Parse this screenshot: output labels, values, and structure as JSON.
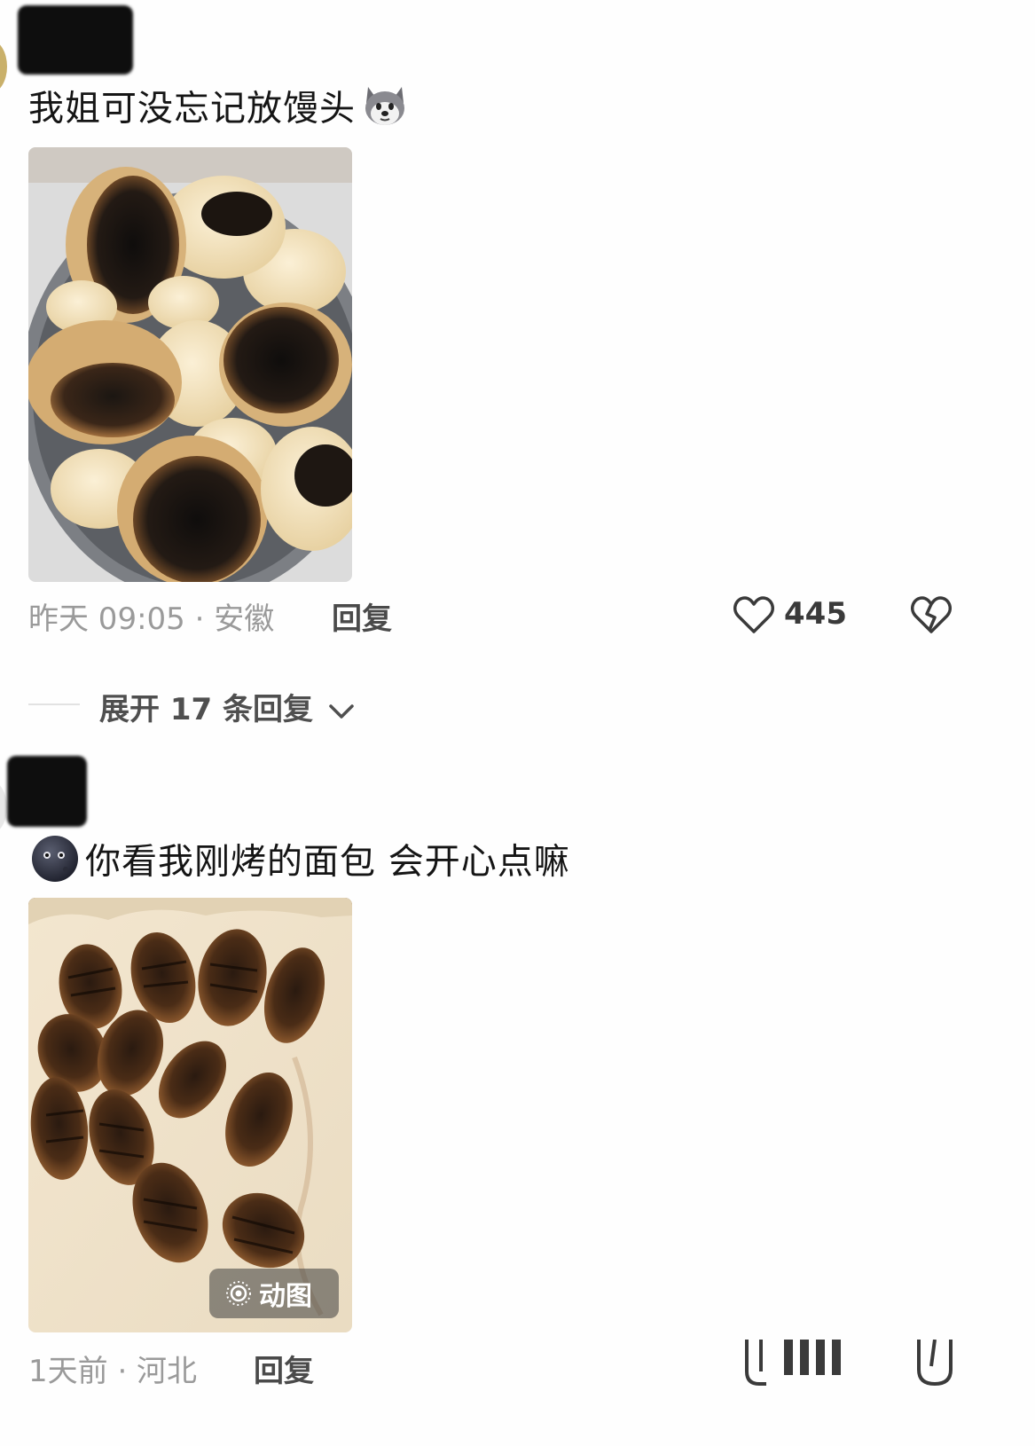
{
  "comments": [
    {
      "text": "我姐可没忘记放馒头",
      "time_location": "昨天 09:05 · 安徽",
      "reply_label": "回复",
      "likes": "445",
      "expand_label": "展开 17 条回复",
      "emoji": "dog-face-emoji"
    },
    {
      "text": "你看我刚烤的面包 会开心点嘛",
      "time_location": "1天前 · 河北",
      "reply_label": "回复",
      "gif_badge": "动图",
      "emoji": "dark-moon-face-emoji"
    }
  ],
  "icons": {
    "like": "heart-outline-icon",
    "dislike": "broken-heart-icon",
    "expand": "chevron-down-icon",
    "gif": "live-photo-icon"
  },
  "colors": {
    "text_primary": "#151515",
    "text_meta": "#9a9a9a",
    "text_action": "#4a4a4a"
  }
}
